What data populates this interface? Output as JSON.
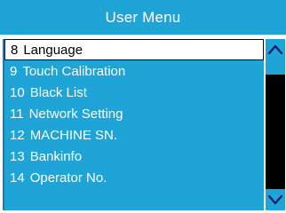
{
  "header": {
    "title": "User Menu"
  },
  "menu": {
    "items": [
      {
        "num": "8",
        "label": "Language",
        "selected": true
      },
      {
        "num": "9",
        "label": "Touch Calibration",
        "selected": false
      },
      {
        "num": "10",
        "label": "Black List",
        "selected": false
      },
      {
        "num": "11",
        "label": "Network Setting",
        "selected": false
      },
      {
        "num": "12",
        "label": "MACHINE SN.",
        "selected": false
      },
      {
        "num": "13",
        "label": "Bankinfo",
        "selected": false
      },
      {
        "num": "14",
        "label": "Operator No.",
        "selected": false
      }
    ]
  },
  "scrollbar": {
    "up_icon": "chevron-up-icon",
    "down_icon": "chevron-down-icon"
  },
  "colors": {
    "accent": "#1ea4d6",
    "selected_bg": "#ffffff",
    "selected_text": "#000000",
    "text": "#ffffff",
    "track": "#000000"
  }
}
